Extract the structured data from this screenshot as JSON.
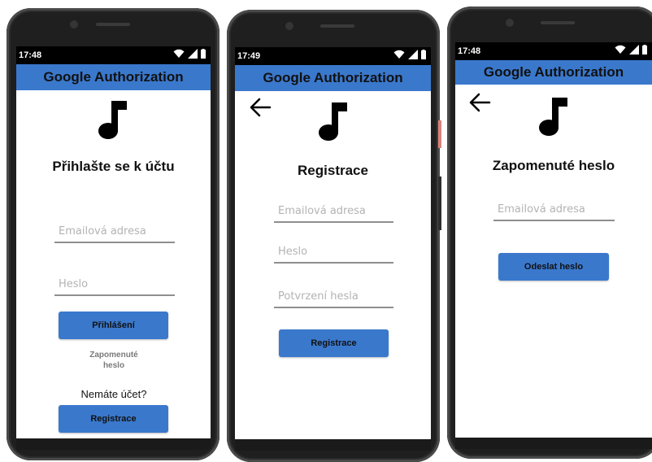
{
  "login": {
    "status_time": "17:48",
    "app_title": "Google Authorization",
    "heading": "Přihlašte se k účtu",
    "email_placeholder": "Emailová adresa",
    "password_placeholder": "Heslo",
    "login_button": "Přihlášení",
    "forgot_line1": "Zapomenuté",
    "forgot_line2": "heslo",
    "no_account": "Nemáte účet?",
    "register_button": "Registrace"
  },
  "register": {
    "status_time": "17:49",
    "app_title": "Google Authorization",
    "heading": "Registrace",
    "email_placeholder": "Emailová adresa",
    "password_placeholder": "Heslo",
    "confirm_placeholder": "Potvrzení hesla",
    "register_button": "Registrace"
  },
  "forgot": {
    "status_time": "17:48",
    "app_title": "Google Authorization",
    "heading": "Zapomenuté heslo",
    "email_placeholder": "Emailová adresa",
    "send_button": "Odeslat heslo"
  },
  "icons": {
    "back": "back-arrow-icon",
    "logo": "music-note-icon",
    "wifi": "wifi-icon",
    "signal": "signal-icon",
    "battery": "battery-icon"
  },
  "colors": {
    "primary": "#3a78cc",
    "status_bar": "#000000",
    "phone_frame": "#1f1f1f"
  }
}
